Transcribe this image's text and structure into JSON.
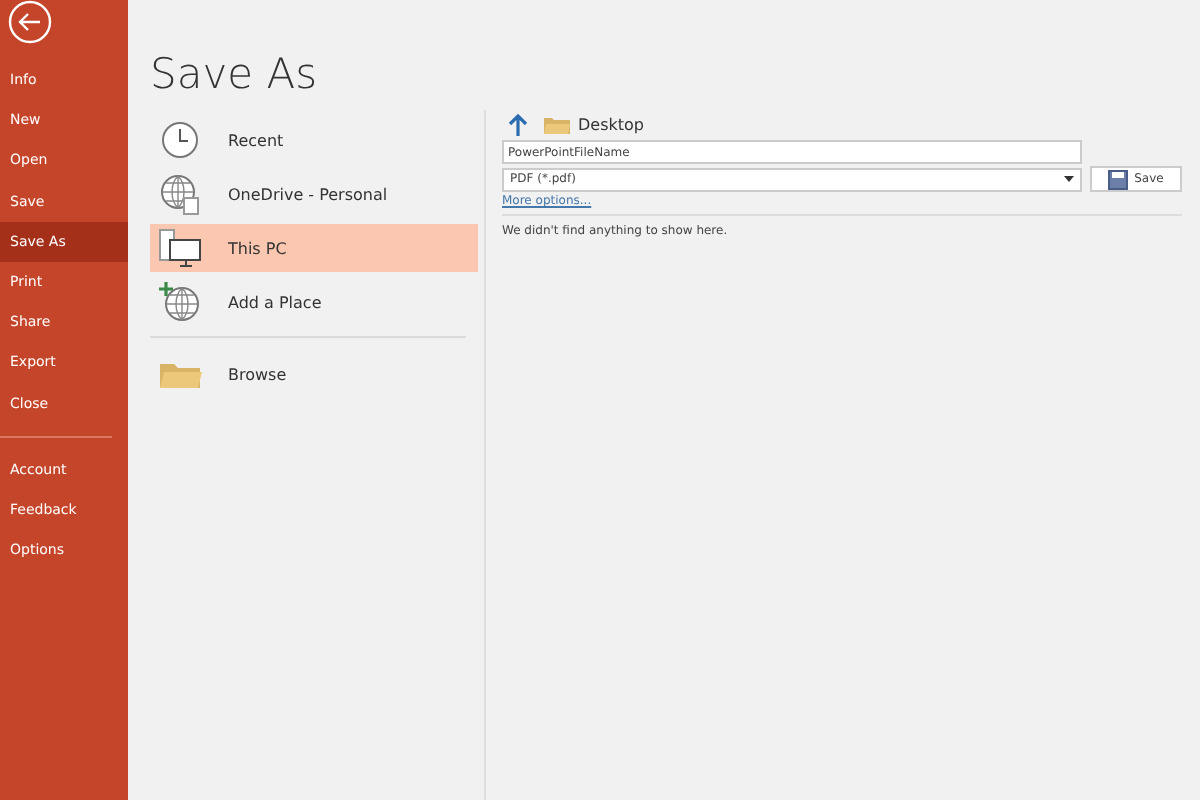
{
  "sidebar": {
    "items": [
      {
        "label": "Info",
        "selected": false
      },
      {
        "label": "New",
        "selected": false
      },
      {
        "label": "Open",
        "selected": false
      },
      {
        "label": "Save",
        "selected": false
      },
      {
        "label": "Save As",
        "selected": true
      },
      {
        "label": "Print",
        "selected": false
      },
      {
        "label": "Share",
        "selected": false
      },
      {
        "label": "Export",
        "selected": false
      },
      {
        "label": "Close",
        "selected": false
      }
    ],
    "footer_items": [
      {
        "label": "Account",
        "selected": false
      },
      {
        "label": "Feedback",
        "selected": false
      },
      {
        "label": "Options",
        "selected": false
      }
    ]
  },
  "title": "Save As",
  "places": [
    {
      "label": "Recent",
      "kind": "recent",
      "selected": false
    },
    {
      "label": "OneDrive - Personal",
      "kind": "cloud",
      "selected": false
    },
    {
      "label": "This PC",
      "kind": "pc",
      "selected": true
    },
    {
      "label": "Add a Place",
      "kind": "add",
      "selected": false
    },
    {
      "label": "Browse",
      "kind": "folder",
      "selected": false
    }
  ],
  "location": {
    "folder": "Desktop"
  },
  "file_name": {
    "value": "PowerPointFileName"
  },
  "file_type": {
    "value": "PDF (*.pdf)"
  },
  "save_button": "Save",
  "more_options": "More options...",
  "empty_message": "We didn't find anything to show here."
}
